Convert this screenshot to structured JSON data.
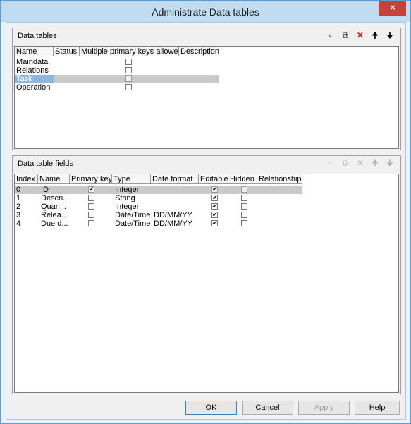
{
  "window": {
    "title": "Administrate Data tables",
    "close_label": "×"
  },
  "data_tables": {
    "label": "Data tables",
    "columns": [
      "Name",
      "Status",
      "Multiple primary keys allowed",
      "Description"
    ],
    "rows": [
      {
        "name": "Maindata",
        "multiple_pk": false
      },
      {
        "name": "Relations",
        "multiple_pk": false
      },
      {
        "name": "Task",
        "multiple_pk": false,
        "selected": true
      },
      {
        "name": "Operation",
        "multiple_pk": false
      }
    ]
  },
  "data_table_fields": {
    "label": "Data table fields",
    "columns": [
      "Index",
      "Name",
      "Primary key",
      "Type",
      "Date format",
      "Editable",
      "Hidden",
      "Relationship"
    ],
    "rows": [
      {
        "index": "0",
        "name": "ID",
        "primary_key": true,
        "type": "Integer",
        "date_format": "",
        "editable": true,
        "hidden": false
      },
      {
        "index": "1",
        "name": "Descri...",
        "primary_key": false,
        "type": "String",
        "date_format": "",
        "editable": true,
        "hidden": false
      },
      {
        "index": "2",
        "name": "Quan...",
        "primary_key": false,
        "type": "Integer",
        "date_format": "",
        "editable": true,
        "hidden": false
      },
      {
        "index": "3",
        "name": "Relea...",
        "primary_key": false,
        "type": "Date/Time",
        "date_format": "DD/MM/YY",
        "editable": true,
        "hidden": false
      },
      {
        "index": "4",
        "name": "Due d...",
        "primary_key": false,
        "type": "Date/Time",
        "date_format": "DD/MM/YY",
        "editable": true,
        "hidden": false
      }
    ]
  },
  "toolbar_icons": [
    "new-icon",
    "copy-icon",
    "delete-icon",
    "move-up-icon",
    "move-down-icon"
  ],
  "toolbar_glyphs": {
    "new": "▫",
    "copy": "⧉",
    "delete": "✕",
    "up": "🠉",
    "down": "🠋"
  },
  "check_glyph": "✔",
  "buttons": {
    "ok": "OK",
    "cancel": "Cancel",
    "apply": "Apply",
    "help": "Help"
  },
  "colors": {
    "title_bar": "#bfdcf2",
    "close_button": "#c7403a",
    "selection": "#8fb7dd",
    "delete_red": "#d02020"
  }
}
